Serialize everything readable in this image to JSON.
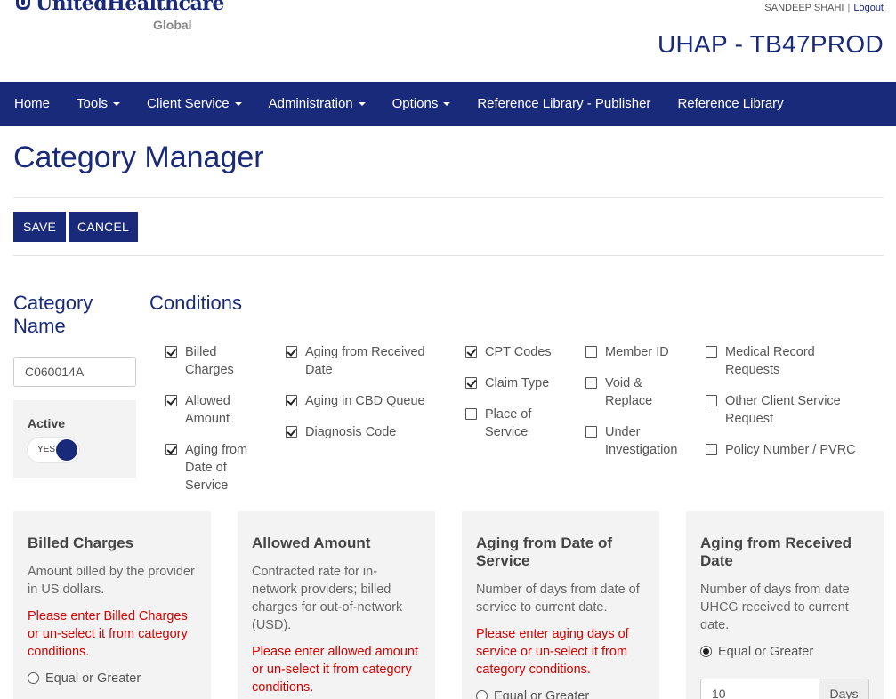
{
  "header": {
    "logo_brand": "UnitedHealthcare",
    "logo_sub": "Global",
    "user_name": "SANDEEP SHAHI",
    "separator": "|",
    "logout_label": "Logout",
    "env_title": "UHAP - TB47PROD"
  },
  "nav": {
    "home": "Home",
    "tools": "Tools",
    "client_service": "Client Service",
    "administration": "Administration",
    "options": "Options",
    "ref_lib_publisher": "Reference Library - Publisher",
    "ref_lib": "Reference Library"
  },
  "page": {
    "title": "Category Manager",
    "save_label": "SAVE",
    "cancel_label": "CANCEL"
  },
  "category": {
    "heading": "Category Name",
    "name_value": "C060014A",
    "active_label": "Active",
    "toggle_text": "YES"
  },
  "conditions": {
    "heading": "Conditions",
    "col1": [
      {
        "label": "Billed Charges",
        "checked": true
      },
      {
        "label": "Allowed Amount",
        "checked": true
      },
      {
        "label": "Aging from Date of Service",
        "checked": true
      }
    ],
    "col2": [
      {
        "label": "Aging from Received Date",
        "checked": true
      },
      {
        "label": "Aging in CBD Queue",
        "checked": true
      },
      {
        "label": "Diagnosis Code",
        "checked": true
      }
    ],
    "col3": [
      {
        "label": "CPT Codes",
        "checked": true
      },
      {
        "label": "Claim Type",
        "checked": true
      },
      {
        "label": "Place of Service",
        "checked": false
      }
    ],
    "col4": [
      {
        "label": "Member ID",
        "checked": false
      },
      {
        "label": "Void & Replace",
        "checked": false
      },
      {
        "label": "Under Investigation",
        "checked": false
      }
    ],
    "col5": [
      {
        "label": "Medical Record Requests",
        "checked": false
      },
      {
        "label": "Other Client Service Request",
        "checked": false
      },
      {
        "label": "Policy Number / PVRC",
        "checked": false
      }
    ]
  },
  "panels": {
    "billed": {
      "title": "Billed Charges",
      "desc": "Amount billed by the provider in US dollars.",
      "error": "Please enter Billed Charges or un-select it from category conditions.",
      "radio_label": "Equal or Greater"
    },
    "allowed": {
      "title": "Allowed Amount",
      "desc": "Contracted rate for in-network providers; billed charges for out-of-network (USD).",
      "error": "Please enter allowed amount or un-select it from category conditions."
    },
    "aging_dos": {
      "title": "Aging from Date of Service",
      "desc": "Number of days from date of service to current date.",
      "error": "Please enter aging days of service or un-select it from category conditions.",
      "radio_label": "Equal or Greater"
    },
    "aging_received": {
      "title": "Aging from Received Date",
      "desc": "Number of days from date UHCG received to current date.",
      "radio_label": "Equal or Greater",
      "days_value": "10",
      "days_addon": "Days"
    }
  },
  "colors": {
    "brand_navy": "#1a2a7a",
    "error_red": "#d50000",
    "panel_bg": "#f3f3f3"
  },
  "icons": [
    "unitedhealthcare-logo-icon",
    "caret-down-icon",
    "checkbox-icon",
    "radio-icon",
    "toggle-icon"
  ]
}
